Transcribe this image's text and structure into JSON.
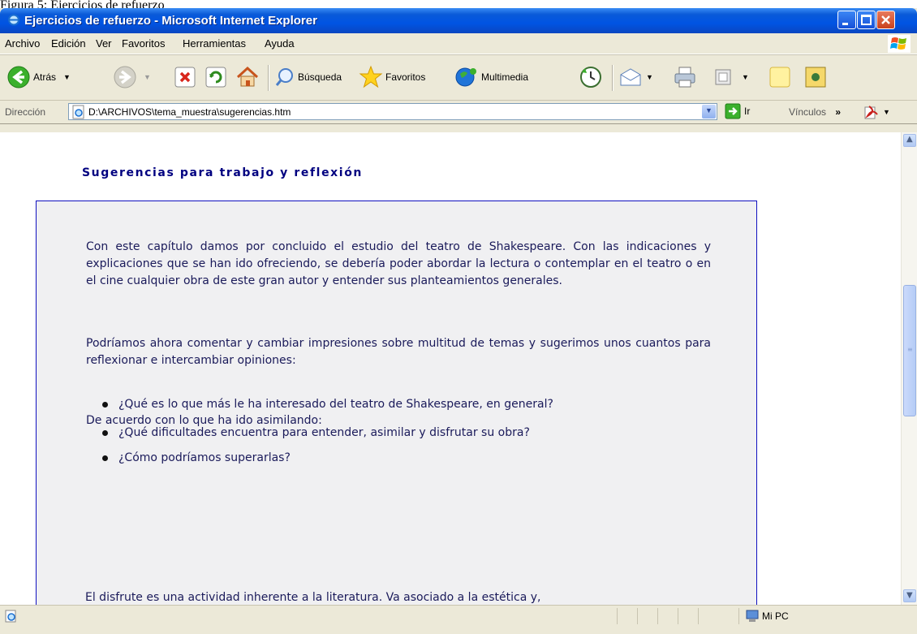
{
  "caption": "Figura 5: Ejercicios de refuerzo",
  "window": {
    "title": "Ejercicios de refuerzo - Microsoft Internet Explorer"
  },
  "menu": [
    "Archivo",
    "Edición",
    "Ver",
    "Favoritos",
    "Herramientas",
    "Ayuda"
  ],
  "toolbar": {
    "back_label": "Atrás",
    "search_label": "Búsqueda",
    "favorites_label": "Favoritos",
    "media_label": "Multimedia"
  },
  "address": {
    "label": "Dirección",
    "url": "D:\\ARCHIVOS\\tema_muestra\\sugerencias.htm",
    "go_label": "Ir",
    "links_label": "Vínculos"
  },
  "page": {
    "title": "Sugerencias para trabajo y reflexión",
    "p1": "Con este capítulo damos por concluido el estudio del teatro de Shakespeare. Con las indicaciones y explicaciones que se han ido ofreciendo, se debería poder abordar la lectura o contemplar en el teatro o en el cine cualquier obra de este gran autor y entender sus planteamientos generales.",
    "p2": "Podríamos ahora comentar y cambiar impresiones sobre multitud de temas y sugerimos unos cuantos para reflexionar e intercambiar opiniones:",
    "p3": "De acuerdo con lo que ha ido asimilando:",
    "bullets": [
      "¿Qué es lo que más le ha interesado del teatro de Shakespeare, en general?",
      "¿Qué dificultades encuentra para entender, asimilar y disfrutar su obra?",
      "¿Cómo podríamos superarlas?"
    ],
    "p4": "El disfrute es una actividad inherente a la literatura. Va asociado a la estética y,"
  },
  "status": {
    "zone": "Mi PC"
  }
}
